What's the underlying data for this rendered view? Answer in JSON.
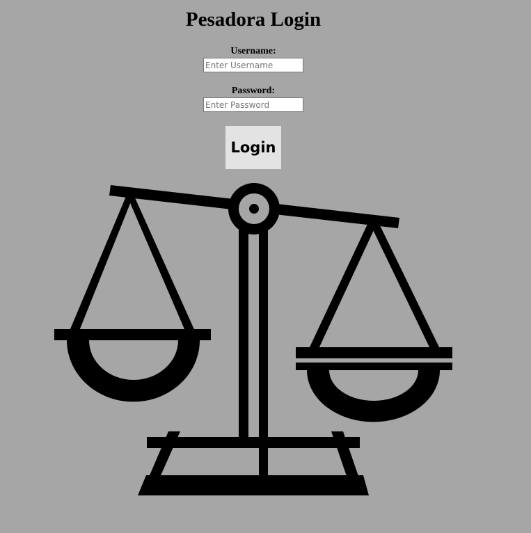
{
  "page": {
    "title": "Pesadora Login",
    "background_color": "#a6a6a6"
  },
  "form": {
    "username_label": "Username:",
    "username_placeholder": "Enter Username",
    "username_value": "",
    "password_label": "Password:",
    "password_placeholder": "Enter Password",
    "password_value": "",
    "login_button": "Login",
    "button_background": "#e3e3e3"
  },
  "illustration": {
    "icon": "balance-scale-icon"
  }
}
